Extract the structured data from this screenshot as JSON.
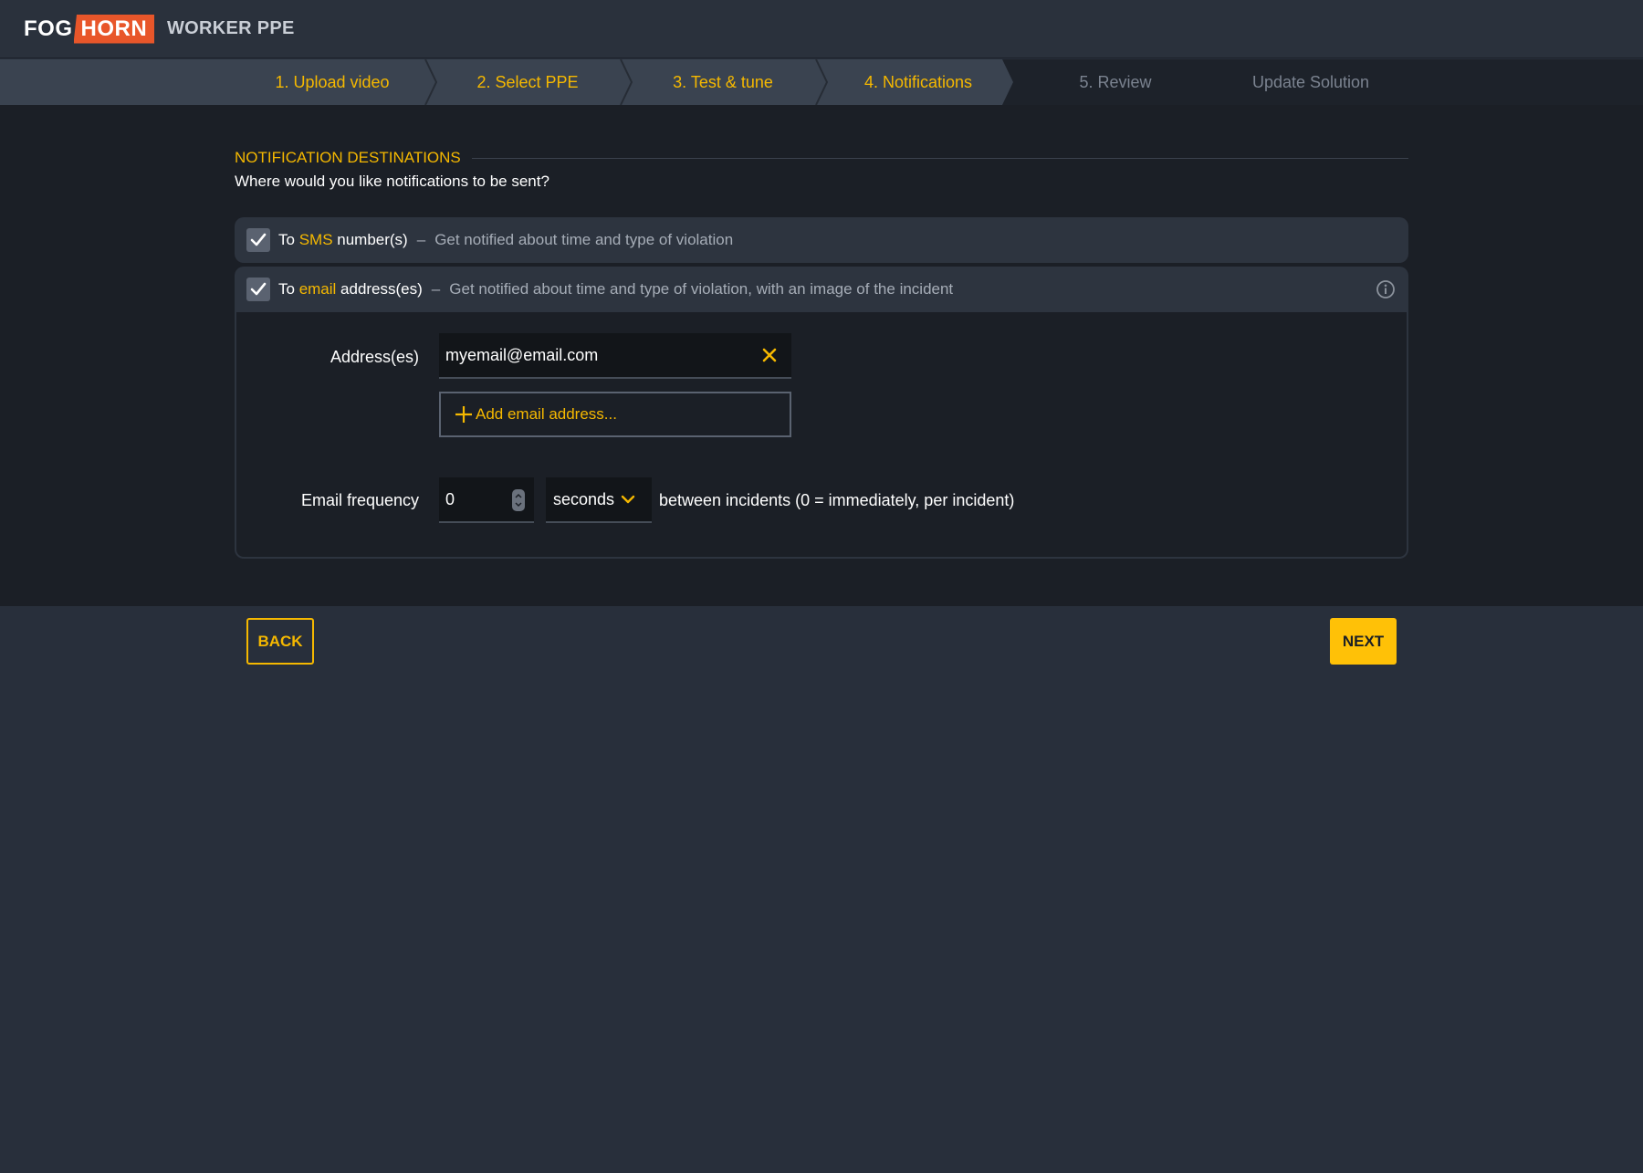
{
  "header": {
    "logo_left": "FOG",
    "logo_right": "HORN",
    "app_title": "WORKER PPE"
  },
  "stepper": {
    "steps": [
      {
        "label": "1. Upload video",
        "state": "done"
      },
      {
        "label": "2. Select PPE",
        "state": "done"
      },
      {
        "label": "3. Test & tune",
        "state": "done"
      },
      {
        "label": "4. Notifications",
        "state": "current"
      },
      {
        "label": "5. Review",
        "state": "todo"
      },
      {
        "label": "Update Solution",
        "state": "todo"
      }
    ]
  },
  "section": {
    "title": "NOTIFICATION DESTINATIONS",
    "subtitle": "Where would you like notifications to be sent?"
  },
  "sms": {
    "checked": true,
    "prefix": "To ",
    "keyword": "SMS",
    "suffix": " number(s)",
    "dash": "–",
    "description": "Get notified about time and type of violation"
  },
  "email": {
    "checked": true,
    "prefix": "To ",
    "keyword": "email",
    "suffix": " address(es)",
    "dash": "–",
    "description": "Get notified about time and type of violation, with an image of the incident",
    "addresses_label": "Address(es)",
    "address_value": "myemail@email.com",
    "add_label": "Add email address...",
    "frequency_label": "Email frequency",
    "frequency_value": "0",
    "frequency_unit": "seconds",
    "frequency_suffix": "between incidents (0 = immediately, per incident)"
  },
  "footer": {
    "back_label": "BACK",
    "next_label": "NEXT"
  },
  "colors": {
    "accent": "#f5b800",
    "brand_orange": "#e8562a",
    "background": "#282f3b",
    "panel": "#1b1f26"
  },
  "icons": {
    "checkbox": "check-icon",
    "info": "info-icon",
    "clear": "close-icon",
    "add": "plus-icon",
    "spinner": "spinner-arrows-icon",
    "select": "chevron-down-icon"
  }
}
